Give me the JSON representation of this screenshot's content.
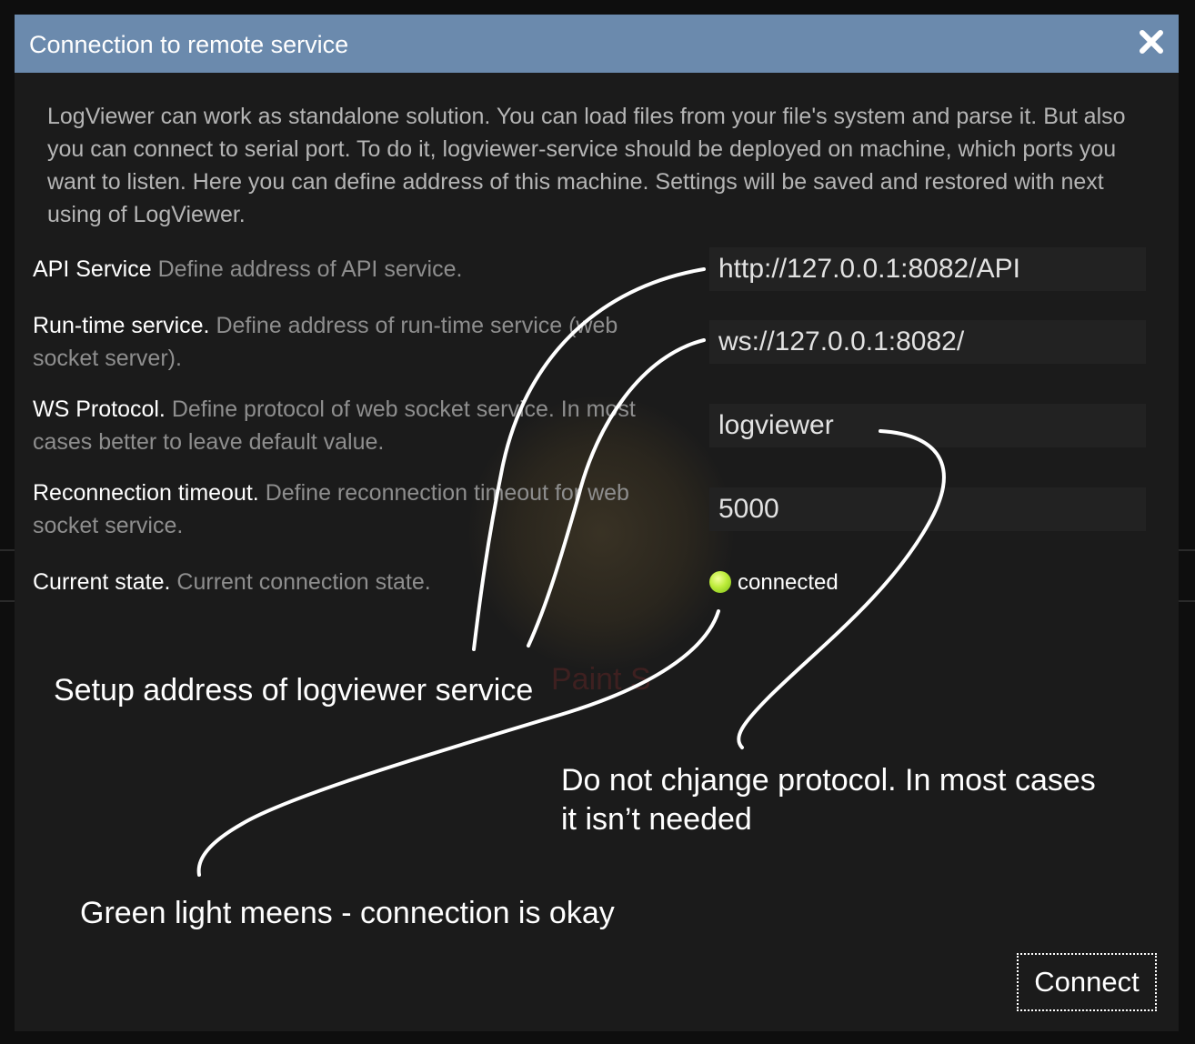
{
  "dialog": {
    "title": "Connection to remote service",
    "description": "LogViewer can work as standalone solution. You can load files from your file's system and parse it. But also you can connect to serial port. To do it, logviewer-service should be deployed on machine, which ports you want to listen. Here you can define address of this machine. Settings will be saved and restored with next using of LogViewer."
  },
  "fields": {
    "api": {
      "label": "API Service",
      "hint": "Define address of API service.",
      "value": "http://127.0.0.1:8082/API"
    },
    "runtime": {
      "label": "Run-time service.",
      "hint": "Define address of run-time service (web socket server).",
      "value": "ws://127.0.0.1:8082/"
    },
    "protocol": {
      "label": "WS Protocol.",
      "hint": "Define protocol of web socket service. In most cases better to leave default value.",
      "value": "logviewer"
    },
    "timeout": {
      "label": "Reconnection timeout.",
      "hint": "Define reconnection timeout for web socket service.",
      "value": "5000"
    },
    "state": {
      "label": "Current state.",
      "hint": "Current connection state.",
      "value": "connected",
      "indicator_color": "#b5e83a"
    }
  },
  "background": {
    "ghost_text": "Paint S"
  },
  "annotations": {
    "setup": "Setup address of logviewer service",
    "protocol": "Do not chjange protocol. In most cases it isn’t needed",
    "green": "Green light meens - connection is okay"
  },
  "actions": {
    "connect_label": "Connect"
  },
  "colors": {
    "titlebar": "#6b8aad",
    "dialog_bg": "#1b1b1b",
    "field_bg": "#222222"
  }
}
